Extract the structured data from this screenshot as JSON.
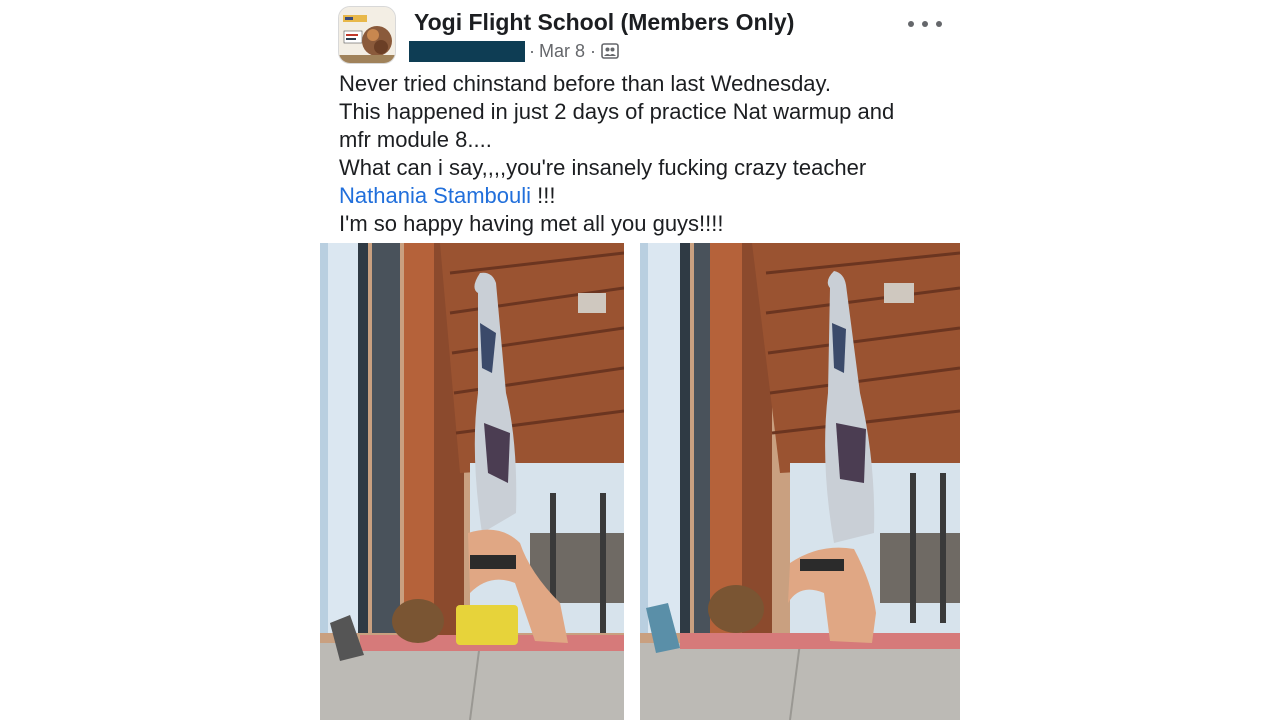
{
  "group": {
    "name": "Yogi Flight School (Members Only)",
    "date": "Mar 8",
    "separator": "·",
    "privacy_icon": "members-icon",
    "avatar_icon": "group-logo"
  },
  "post": {
    "line1": "Never tried chinstand before than last Wednesday.",
    "line2": "This happened in just 2 days of practice Nat warmup and",
    "line3": "mfr module 8....",
    "line4": "What can i say,,,,you're insanely fucking crazy teacher",
    "mention": "Nathania Stambouli",
    "mention_suffix": " !!!",
    "line6": "I'm so happy having met all you guys!!!!"
  },
  "colors": {
    "mention": "#216fdb",
    "redaction": "#0e3d54",
    "text": "#1c1e21",
    "meta": "#65676b"
  }
}
